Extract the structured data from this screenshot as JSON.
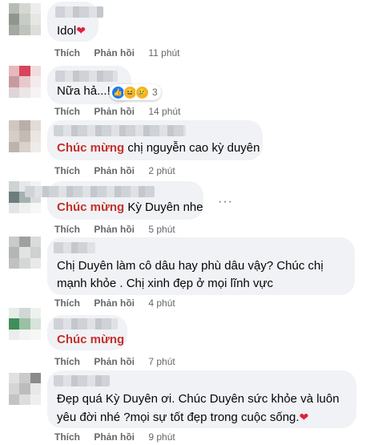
{
  "actions": {
    "like": "Thích",
    "reply": "Phản hồi"
  },
  "comments": [
    {
      "text": "Idol",
      "emoji": "❤",
      "time": "11 phút"
    },
    {
      "text": "Nữa hả...!",
      "time": "14 phút",
      "reaction_count": "3",
      "reaction_icons": [
        "like-reaction-icon",
        "haha-reaction-icon",
        "sad-reaction-icon"
      ]
    },
    {
      "highlight": "Chúc mừng",
      "text": " chị nguyễn cao kỳ duyên",
      "time": "2 phút"
    },
    {
      "highlight": "Chúc mừng",
      "text": " Kỳ Duyên nhe",
      "time": "5 phút"
    },
    {
      "text": "Chị Duyên làm cô dâu hay phù dâu vậy? Chúc chị mạnh khỏe . Chị xinh đẹp ở mọi lĩnh vực",
      "time": "4 phút"
    },
    {
      "highlight": "Chúc mừng",
      "time": "7 phút"
    },
    {
      "text": "Đẹp quá Kỳ Duyên ơi. Chúc Duyên sức khỏe và luôn yêu đời nhé ?mọi sự tốt đẹp trong cuộc sống.",
      "emoji": "❤",
      "time": "9 phút"
    }
  ],
  "more_options": "···",
  "colors": {
    "bubble": "#f0f2f5",
    "highlight": "#c4302b",
    "heart": "#e41e3f",
    "meta": "#65676b"
  }
}
